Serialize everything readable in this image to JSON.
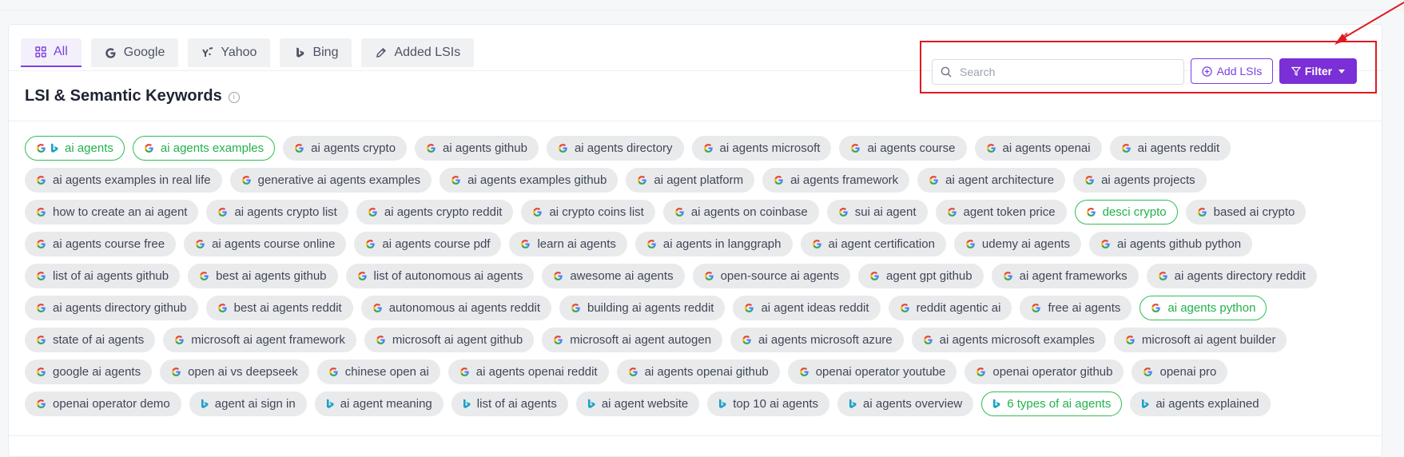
{
  "colors": {
    "accent": "#7b3fe4",
    "highlight": "#22b14c",
    "annotation": "#e0191f"
  },
  "tabs": [
    {
      "label": "All",
      "icon": "grid-icon",
      "active": true
    },
    {
      "label": "Google",
      "icon": "google-icon",
      "active": false
    },
    {
      "label": "Yahoo",
      "icon": "yahoo-icon",
      "active": false
    },
    {
      "label": "Bing",
      "icon": "bing-icon",
      "active": false
    },
    {
      "label": "Added LSIs",
      "icon": "pencil-icon",
      "active": false
    }
  ],
  "header": {
    "title": "LSI & Semantic Keywords",
    "info": "i"
  },
  "search": {
    "placeholder": "Search"
  },
  "buttons": {
    "add_lsis": "Add LSIs",
    "filter": "Filter"
  },
  "keywords": [
    {
      "text": "ai agents",
      "sources": [
        "google",
        "bing"
      ],
      "highlighted": true
    },
    {
      "text": "ai agents examples",
      "sources": [
        "google"
      ],
      "highlighted": true
    },
    {
      "text": "ai agents crypto",
      "sources": [
        "google"
      ],
      "highlighted": false
    },
    {
      "text": "ai agents github",
      "sources": [
        "google"
      ],
      "highlighted": false
    },
    {
      "text": "ai agents directory",
      "sources": [
        "google"
      ],
      "highlighted": false
    },
    {
      "text": "ai agents microsoft",
      "sources": [
        "google"
      ],
      "highlighted": false
    },
    {
      "text": "ai agents course",
      "sources": [
        "google"
      ],
      "highlighted": false
    },
    {
      "text": "ai agents openai",
      "sources": [
        "google"
      ],
      "highlighted": false
    },
    {
      "text": "ai agents reddit",
      "sources": [
        "google"
      ],
      "highlighted": false
    },
    {
      "text": "ai agents examples in real life",
      "sources": [
        "google"
      ],
      "highlighted": false
    },
    {
      "text": "generative ai agents examples",
      "sources": [
        "google"
      ],
      "highlighted": false
    },
    {
      "text": "ai agents examples github",
      "sources": [
        "google"
      ],
      "highlighted": false
    },
    {
      "text": "ai agent platform",
      "sources": [
        "google"
      ],
      "highlighted": false
    },
    {
      "text": "ai agents framework",
      "sources": [
        "google"
      ],
      "highlighted": false
    },
    {
      "text": "ai agent architecture",
      "sources": [
        "google"
      ],
      "highlighted": false
    },
    {
      "text": "ai agents projects",
      "sources": [
        "google"
      ],
      "highlighted": false
    },
    {
      "text": "how to create an ai agent",
      "sources": [
        "google"
      ],
      "highlighted": false
    },
    {
      "text": "ai agents crypto list",
      "sources": [
        "google"
      ],
      "highlighted": false
    },
    {
      "text": "ai agents crypto reddit",
      "sources": [
        "google"
      ],
      "highlighted": false
    },
    {
      "text": "ai crypto coins list",
      "sources": [
        "google"
      ],
      "highlighted": false
    },
    {
      "text": "ai agents on coinbase",
      "sources": [
        "google"
      ],
      "highlighted": false
    },
    {
      "text": "sui ai agent",
      "sources": [
        "google"
      ],
      "highlighted": false
    },
    {
      "text": "agent token price",
      "sources": [
        "google"
      ],
      "highlighted": false
    },
    {
      "text": "desci crypto",
      "sources": [
        "google"
      ],
      "highlighted": true
    },
    {
      "text": "based ai crypto",
      "sources": [
        "google"
      ],
      "highlighted": false
    },
    {
      "text": "ai agents course free",
      "sources": [
        "google"
      ],
      "highlighted": false
    },
    {
      "text": "ai agents course online",
      "sources": [
        "google"
      ],
      "highlighted": false
    },
    {
      "text": "ai agents course pdf",
      "sources": [
        "google"
      ],
      "highlighted": false
    },
    {
      "text": "learn ai agents",
      "sources": [
        "google"
      ],
      "highlighted": false
    },
    {
      "text": "ai agents in langgraph",
      "sources": [
        "google"
      ],
      "highlighted": false
    },
    {
      "text": "ai agent certification",
      "sources": [
        "google"
      ],
      "highlighted": false
    },
    {
      "text": "udemy ai agents",
      "sources": [
        "google"
      ],
      "highlighted": false
    },
    {
      "text": "ai agents github python",
      "sources": [
        "google"
      ],
      "highlighted": false
    },
    {
      "text": "list of ai agents github",
      "sources": [
        "google"
      ],
      "highlighted": false
    },
    {
      "text": "best ai agents github",
      "sources": [
        "google"
      ],
      "highlighted": false
    },
    {
      "text": "list of autonomous ai agents",
      "sources": [
        "google"
      ],
      "highlighted": false
    },
    {
      "text": "awesome ai agents",
      "sources": [
        "google"
      ],
      "highlighted": false
    },
    {
      "text": "open-source ai agents",
      "sources": [
        "google"
      ],
      "highlighted": false
    },
    {
      "text": "agent gpt github",
      "sources": [
        "google"
      ],
      "highlighted": false
    },
    {
      "text": "ai agent frameworks",
      "sources": [
        "google"
      ],
      "highlighted": false
    },
    {
      "text": "ai agents directory reddit",
      "sources": [
        "google"
      ],
      "highlighted": false
    },
    {
      "text": "ai agents directory github",
      "sources": [
        "google"
      ],
      "highlighted": false
    },
    {
      "text": "best ai agents reddit",
      "sources": [
        "google"
      ],
      "highlighted": false
    },
    {
      "text": "autonomous ai agents reddit",
      "sources": [
        "google"
      ],
      "highlighted": false
    },
    {
      "text": "building ai agents reddit",
      "sources": [
        "google"
      ],
      "highlighted": false
    },
    {
      "text": "ai agent ideas reddit",
      "sources": [
        "google"
      ],
      "highlighted": false
    },
    {
      "text": "reddit agentic ai",
      "sources": [
        "google"
      ],
      "highlighted": false
    },
    {
      "text": "free ai agents",
      "sources": [
        "google"
      ],
      "highlighted": false
    },
    {
      "text": "ai agents python",
      "sources": [
        "google"
      ],
      "highlighted": true
    },
    {
      "text": "state of ai agents",
      "sources": [
        "google"
      ],
      "highlighted": false
    },
    {
      "text": "microsoft ai agent framework",
      "sources": [
        "google"
      ],
      "highlighted": false
    },
    {
      "text": "microsoft ai agent github",
      "sources": [
        "google"
      ],
      "highlighted": false
    },
    {
      "text": "microsoft ai agent autogen",
      "sources": [
        "google"
      ],
      "highlighted": false
    },
    {
      "text": "ai agents microsoft azure",
      "sources": [
        "google"
      ],
      "highlighted": false
    },
    {
      "text": "ai agents microsoft examples",
      "sources": [
        "google"
      ],
      "highlighted": false
    },
    {
      "text": "microsoft ai agent builder",
      "sources": [
        "google"
      ],
      "highlighted": false
    },
    {
      "text": "google ai agents",
      "sources": [
        "google"
      ],
      "highlighted": false
    },
    {
      "text": "open ai vs deepseek",
      "sources": [
        "google"
      ],
      "highlighted": false
    },
    {
      "text": "chinese open ai",
      "sources": [
        "google"
      ],
      "highlighted": false
    },
    {
      "text": "ai agents openai reddit",
      "sources": [
        "google"
      ],
      "highlighted": false
    },
    {
      "text": "ai agents openai github",
      "sources": [
        "google"
      ],
      "highlighted": false
    },
    {
      "text": "openai operator youtube",
      "sources": [
        "google"
      ],
      "highlighted": false
    },
    {
      "text": "openai operator github",
      "sources": [
        "google"
      ],
      "highlighted": false
    },
    {
      "text": "openai pro",
      "sources": [
        "google"
      ],
      "highlighted": false
    },
    {
      "text": "openai operator demo",
      "sources": [
        "google"
      ],
      "highlighted": false
    },
    {
      "text": "agent ai sign in",
      "sources": [
        "bing"
      ],
      "highlighted": false
    },
    {
      "text": "ai agent meaning",
      "sources": [
        "bing"
      ],
      "highlighted": false
    },
    {
      "text": "list of ai agents",
      "sources": [
        "bing"
      ],
      "highlighted": false
    },
    {
      "text": "ai agent website",
      "sources": [
        "bing"
      ],
      "highlighted": false
    },
    {
      "text": "top 10 ai agents",
      "sources": [
        "bing"
      ],
      "highlighted": false
    },
    {
      "text": "ai agents overview",
      "sources": [
        "bing"
      ],
      "highlighted": false
    },
    {
      "text": "6 types of ai agents",
      "sources": [
        "bing"
      ],
      "highlighted": true
    },
    {
      "text": "ai agents explained",
      "sources": [
        "bing"
      ],
      "highlighted": false
    }
  ]
}
